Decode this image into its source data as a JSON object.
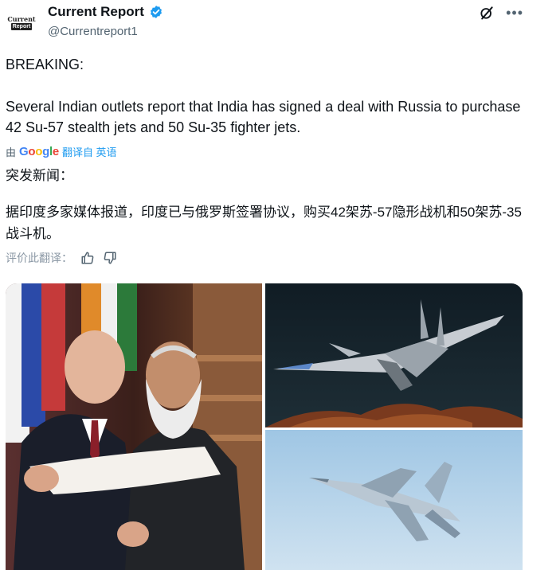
{
  "account": {
    "avatar_top": "Current",
    "avatar_bottom": "Report",
    "name": "Current Report",
    "handle": "@Currentreport1",
    "verified": true
  },
  "header_icons": [
    "grok-icon",
    "more-icon"
  ],
  "tweet": {
    "breaking": "BREAKING:",
    "body": "Several Indian outlets report that India has signed a deal with Russia to purchase 42 Su-57 stealth jets and 50 Su-35 fighter jets."
  },
  "translation": {
    "by": "由",
    "google": "Google",
    "translated_from": "翻译自 英语",
    "breaking": "突发新闻：",
    "body": "据印度多家媒体报道，印度已与俄罗斯签署协议，购买42架苏-57隐形战机和50架苏-35战斗机。",
    "rate": "评价此翻译："
  },
  "colors": {
    "text": "#0f1419",
    "secondary": "#536471",
    "link": "#1d9bf0",
    "verified": "#1d9bf0"
  }
}
